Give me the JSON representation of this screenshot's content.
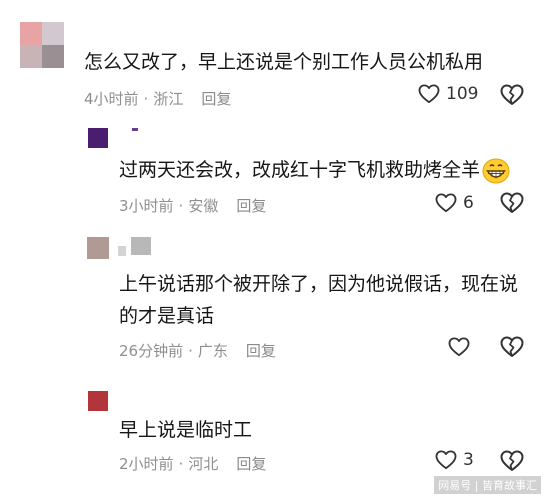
{
  "comments": [
    {
      "text": "怎么又改了，早上还说是个别工作人员公机私用",
      "time": "4小时前",
      "location": "浙江",
      "reply_label": "回复",
      "likes": "109"
    },
    {
      "text": "过两天还会改，改成红十字飞机救助烤全羊",
      "emoji_name": "grinning-face-icon",
      "time": "3小时前",
      "location": "安徽",
      "reply_label": "回复",
      "likes": "6"
    },
    {
      "text_line1": "上午说话那个被开除了，因为他说假话，现在说",
      "text_line2": "的才是真话",
      "time": "26分钟前",
      "location": "广东",
      "reply_label": "回复",
      "likes": ""
    },
    {
      "text": "早上说是临时工",
      "time": "2小时前",
      "location": "河北",
      "reply_label": "回复",
      "likes": "3"
    }
  ],
  "separator": "·",
  "watermark": "网易号 | 皆育故事汇",
  "colors": {
    "meta": "#8f8f8f",
    "text": "#161616"
  }
}
